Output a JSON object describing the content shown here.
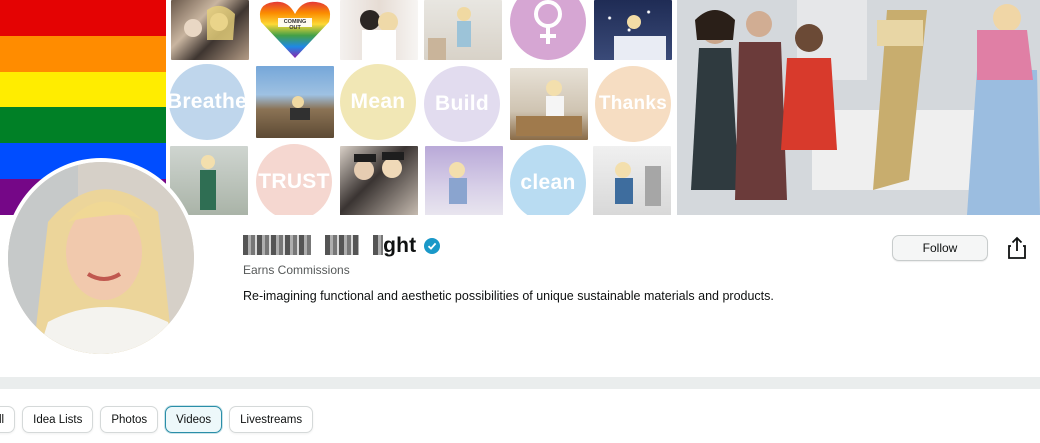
{
  "banner": {
    "rainbow_colors": [
      "#e40303",
      "#ff8c00",
      "#ffed00",
      "#008026",
      "#004dff",
      "#750787"
    ],
    "pride_card_text": "COMING OUT",
    "circle_words": [
      {
        "word": "Breathe",
        "color": "#bfd6ec"
      },
      {
        "word": "Mean",
        "color": "#f1e7b5"
      },
      {
        "word": "Build",
        "color": "#e2dcef"
      },
      {
        "word": "Thanks",
        "color": "#f6ddc2"
      },
      {
        "word": "TRUST",
        "color": "#f5d7d0"
      },
      {
        "word": "clean",
        "color": "#b9dcf2"
      }
    ],
    "venus_circle_color": "#d6a6d3"
  },
  "profile": {
    "name_visible": "ght",
    "earns_label": "Earns Commissions",
    "bio": "Re-imagining functional and aesthetic possibilities of unique sustainable materials and products.",
    "follow_label": "Follow",
    "verified_color": "#1a98c8"
  },
  "tabs": [
    {
      "label": "ll",
      "active": false
    },
    {
      "label": "Idea Lists",
      "active": false
    },
    {
      "label": "Photos",
      "active": false
    },
    {
      "label": "Videos",
      "active": true
    },
    {
      "label": "Livestreams",
      "active": false
    }
  ]
}
